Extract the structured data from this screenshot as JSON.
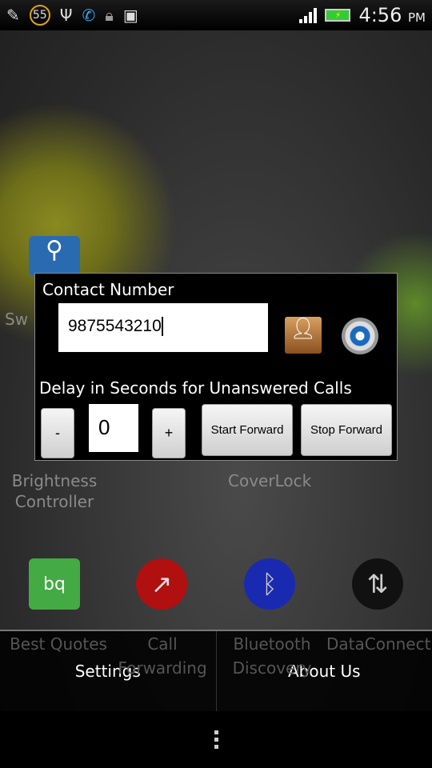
{
  "status_bar": {
    "notification_count": "55",
    "time": "4:56",
    "ampm": "PM",
    "battery": "charging",
    "icons": [
      "edit-icon",
      "usb-icon",
      "call-forward-icon",
      "lock-icon",
      "android-icon"
    ]
  },
  "home": {
    "labels": {
      "brightness": "Brightness\nController",
      "coverlock": "CoverLock",
      "sw": "Sw"
    },
    "dock_labels": [
      "Best Quotes",
      "Call Forwarding",
      "Bluetooth Discovery",
      "DataConnect"
    ]
  },
  "dialog": {
    "contact_label": "Contact Number",
    "contact_value": "9875543210",
    "delay_label": "Delay in Seconds for Unanswered Calls",
    "minus": "-",
    "delay_value": "0",
    "plus": "+",
    "start": "Start Forward",
    "stop": "Stop Forward"
  },
  "menu": {
    "settings": "Settings",
    "about": "About Us"
  }
}
